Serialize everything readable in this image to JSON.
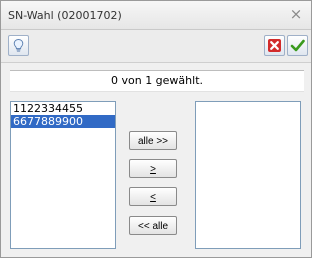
{
  "window": {
    "title": "SN-Wahl (02001702)",
    "close_glyph": "×"
  },
  "toolbar": {
    "info_icon": "lightbulb-icon",
    "cancel_icon": "red-x-icon",
    "confirm_icon": "green-check-icon"
  },
  "status_text": "0 von 1 gewählt.",
  "available_list": {
    "items": [
      {
        "label": "1122334455",
        "selected": false
      },
      {
        "label": "6677889900",
        "selected": true
      }
    ]
  },
  "chosen_list": {
    "items": []
  },
  "move_buttons": {
    "all_right": "alle >>",
    "one_right": ">",
    "one_left": "<",
    "all_left": "<< alle"
  },
  "colors": {
    "selection": "#316ac5",
    "list_border": "#7f9db9"
  }
}
